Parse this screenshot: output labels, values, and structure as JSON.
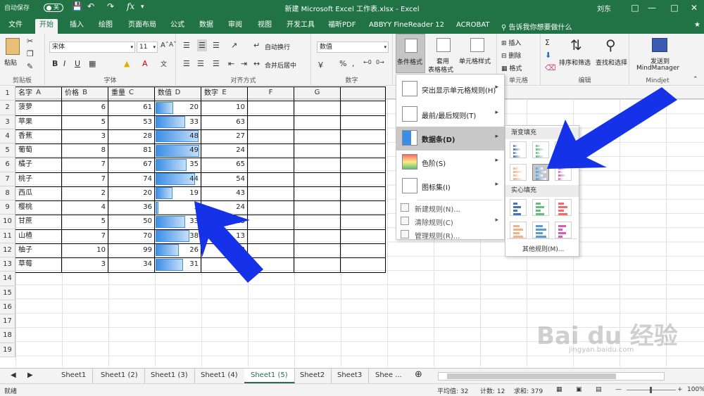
{
  "app": {
    "autosave_label": "自动保存",
    "autosave_state": "关",
    "title": "新建 Microsoft Excel 工作表.xlsx  -  Excel",
    "user": "刘东",
    "fx_symbol": "fx"
  },
  "tabs": [
    "文件",
    "开始",
    "插入",
    "绘图",
    "页面布局",
    "公式",
    "数据",
    "审阅",
    "视图",
    "开发工具",
    "福昕PDF",
    "ABBYY FineReader 12",
    "ACROBAT"
  ],
  "tell_me": "告诉我你想要做什么",
  "ribbon": {
    "paste": "粘贴",
    "clipboard": "剪贴板",
    "font_name": "宋体",
    "font_size": "11",
    "bold": "B",
    "italic": "I",
    "underline": "U",
    "font_group": "字体",
    "wrap_text": "自动换行",
    "merge_center": "合并后居中",
    "align_group": "对齐方式",
    "number_format": "数值",
    "percent": "%",
    "comma": ",",
    "number_group": "数字",
    "cond_format_line1": "条件格式",
    "table_format_line1": "套用",
    "table_format_line2": "表格格式",
    "cell_style": "单元格样式",
    "insert": "插入",
    "delete": "删除",
    "format": "格式",
    "cells_group": "单元格",
    "sort_filter": "排序和筛选",
    "find_select": "查找和选择",
    "edit_group": "编辑",
    "mindmanager_line1": "发送到",
    "mindmanager_line2": "MindManager",
    "mindjet_group": "Mindjet"
  },
  "columns": [
    "A",
    "B",
    "C",
    "D",
    "E",
    "F",
    "G"
  ],
  "headers": [
    "名字",
    "价格",
    "重量",
    "数值",
    "数字"
  ],
  "rows": [
    {
      "name": "菠萝",
      "price": "6",
      "weight": "61",
      "value": "20",
      "num": "10"
    },
    {
      "name": "苹果",
      "price": "5",
      "weight": "53",
      "value": "33",
      "num": "63"
    },
    {
      "name": "香蕉",
      "price": "3",
      "weight": "28",
      "value": "48",
      "num": "27"
    },
    {
      "name": "葡萄",
      "price": "8",
      "weight": "81",
      "value": "49",
      "num": "24"
    },
    {
      "name": "橘子",
      "price": "7",
      "weight": "67",
      "value": "35",
      "num": "65"
    },
    {
      "name": "桃子",
      "price": "7",
      "weight": "74",
      "value": "44",
      "num": "54"
    },
    {
      "name": "西瓜",
      "price": "2",
      "weight": "20",
      "value": "19",
      "num": "43"
    },
    {
      "name": "樱桃",
      "price": "4",
      "weight": "36",
      "value": "3",
      "num": "24"
    },
    {
      "name": "甘蔗",
      "price": "5",
      "weight": "50",
      "value": "33",
      "num": "13"
    },
    {
      "name": "山楂",
      "price": "7",
      "weight": "70",
      "value": "38",
      "num": "13"
    },
    {
      "name": "柚子",
      "price": "10",
      "weight": "99",
      "value": "26",
      "num": "33"
    },
    {
      "name": "草莓",
      "price": "3",
      "weight": "34",
      "value": "31",
      "num": "67"
    }
  ],
  "row_numbers": [
    "1",
    "2",
    "3",
    "4",
    "5",
    "6",
    "7",
    "8",
    "9",
    "10",
    "11",
    "12",
    "13",
    "14",
    "15",
    "16",
    "17",
    "18",
    "19"
  ],
  "data_bar_max": 49,
  "cf_menu": {
    "items": [
      {
        "label": "突出显示单元格规则(H)"
      },
      {
        "label": "最前/最后规则(T)"
      },
      {
        "label": "数据条(D)"
      },
      {
        "label": "色阶(S)"
      },
      {
        "label": "图标集(I)"
      }
    ],
    "small_items": [
      {
        "label": "新建规则(N)..."
      },
      {
        "label": "清除规则(C)"
      },
      {
        "label": "管理规则(R)..."
      }
    ]
  },
  "databar_submenu": {
    "gradient_header": "渐变填充",
    "solid_header": "实心填充",
    "more_rules": "其他规则(M)..."
  },
  "sheet_tabs": [
    "Sheet1",
    "Sheet1 (2)",
    "Sheet1 (3)",
    "Sheet1 (4)",
    "Sheet1 (5)",
    "Sheet2",
    "Sheet3",
    "Shee ..."
  ],
  "active_sheet": "Sheet1 (5)",
  "status": {
    "ready": "就绪",
    "average": "平均值: 32",
    "count": "计数: 12",
    "sum": "求和: 379",
    "zoom": "100%"
  },
  "watermark": {
    "line1": "Bai du 经验",
    "line2": "jingyan.baidu.com"
  },
  "colors": {
    "excel_green": "#217346",
    "arrow_blue": "#1632e8",
    "bar_blue": "#3b8ee6"
  }
}
